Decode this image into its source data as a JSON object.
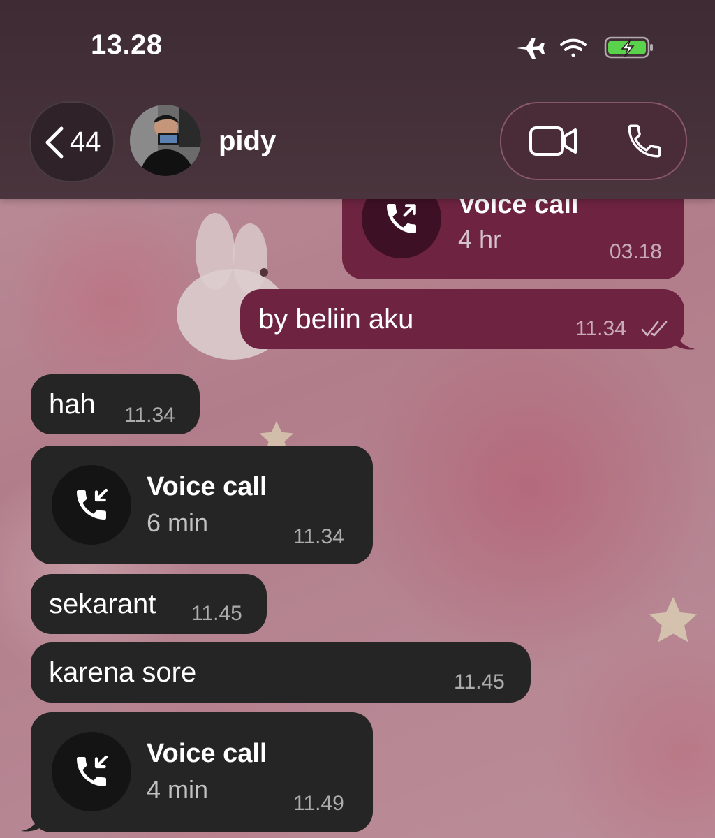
{
  "status_bar": {
    "time": "13.28",
    "icons": [
      "airplane-icon",
      "wifi-icon",
      "battery-charging-icon"
    ]
  },
  "header": {
    "back_count": "44",
    "contact_name": "pidy",
    "actions": [
      "video-call-icon",
      "phone-call-icon"
    ]
  },
  "colors": {
    "outgoing_bubble": "#6e2440",
    "incoming_bubble": "#262525",
    "header": "#3e2b33",
    "accent": "#ffaac8"
  },
  "messages": [
    {
      "type": "call",
      "direction": "outgoing",
      "title": "Voice call",
      "duration": "4 hr",
      "time": "03.18",
      "icon": "outgoing-call-icon"
    },
    {
      "type": "text",
      "direction": "outgoing",
      "text": "by beliin aku",
      "time": "11.34",
      "status": "read-double-check"
    },
    {
      "type": "text",
      "direction": "incoming",
      "text": "hah",
      "time": "11.34"
    },
    {
      "type": "call",
      "direction": "incoming",
      "title": "Voice call",
      "duration": "6 min",
      "time": "11.34",
      "icon": "incoming-call-icon"
    },
    {
      "type": "text",
      "direction": "incoming",
      "text": "sekarant",
      "time": "11.45"
    },
    {
      "type": "text",
      "direction": "incoming",
      "text": "karena sore",
      "time": "11.45"
    },
    {
      "type": "call",
      "direction": "incoming",
      "title": "Voice call",
      "duration": "4 min",
      "time": "11.49",
      "icon": "incoming-call-icon"
    }
  ]
}
